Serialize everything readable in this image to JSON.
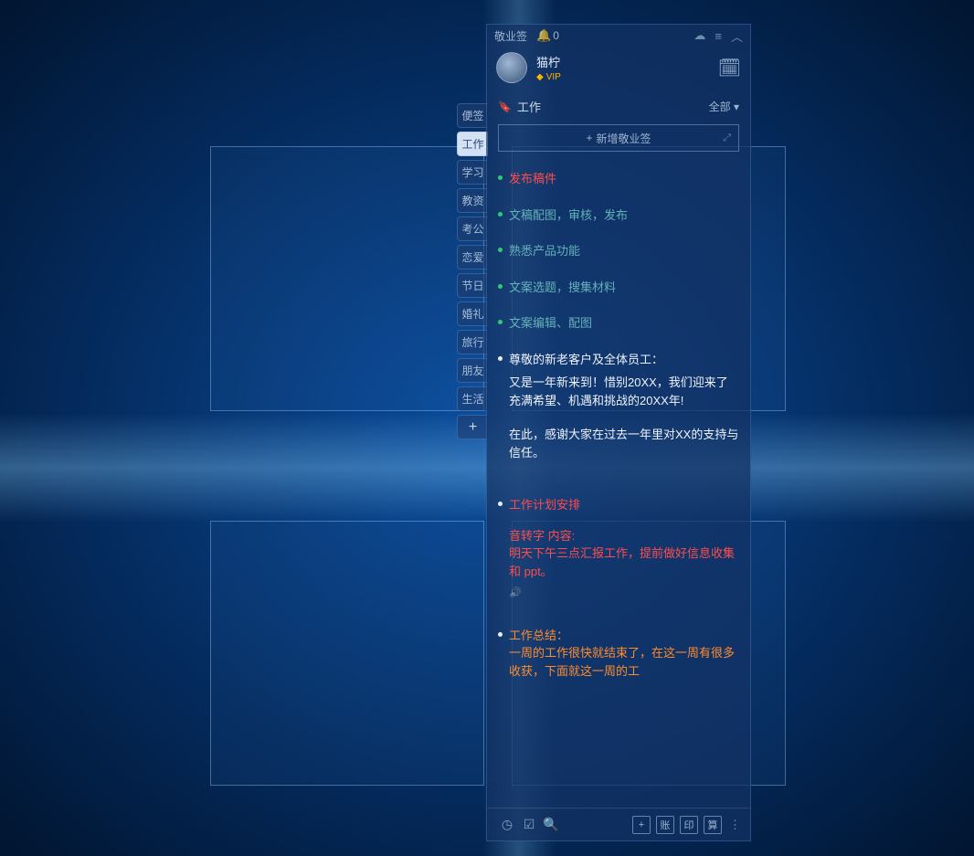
{
  "app": {
    "title": "敬业签",
    "bell_count": "0"
  },
  "user": {
    "name": "猫柠",
    "vip_label": "VIP"
  },
  "section": {
    "bookmark_icon": "work",
    "title": "工作",
    "filter": "全部",
    "add_label": "新增敬业签"
  },
  "side_tabs": [
    "便签",
    "工作",
    "学习",
    "教资",
    "考公",
    "恋爱",
    "节日",
    "婚礼",
    "旅行",
    "朋友",
    "生活"
  ],
  "side_add": "+",
  "notes": [
    {
      "dot": "green",
      "title": "发布稿件",
      "color": "red"
    },
    {
      "dot": "green",
      "title": "文稿配图，审核，发布",
      "color": "teal"
    },
    {
      "dot": "green",
      "title": "熟悉产品功能",
      "color": "teal"
    },
    {
      "dot": "green",
      "title": "文案选题，搜集材料",
      "color": "teal"
    },
    {
      "dot": "green",
      "title": "文案编辑、配图",
      "color": "teal"
    },
    {
      "dot": "white",
      "title": "尊敬的新老客户及全体员工：",
      "color": "white",
      "body": "又是一年新来到！惜别20XX，我们迎来了充满希望、机遇和挑战的20XX年!",
      "body2": "在此，感谢大家在过去一年里对XX的支持与信任。"
    },
    {
      "dot": "white",
      "title": "工作计划安排",
      "color": "red",
      "sub_label": "音转字 内容:",
      "sub": "明天下午三点汇报工作，提前做好信息收集和 ppt。",
      "speaker": true
    },
    {
      "dot": "white",
      "title": "工作总结：",
      "color": "orange",
      "body": "一周的工作很快就结束了，在这一周有很多收获，下面就这一周的工"
    }
  ],
  "bottom": {
    "btn_plus": "+",
    "btn_zhang": "账",
    "btn_yin": "印",
    "btn_suan": "算"
  }
}
